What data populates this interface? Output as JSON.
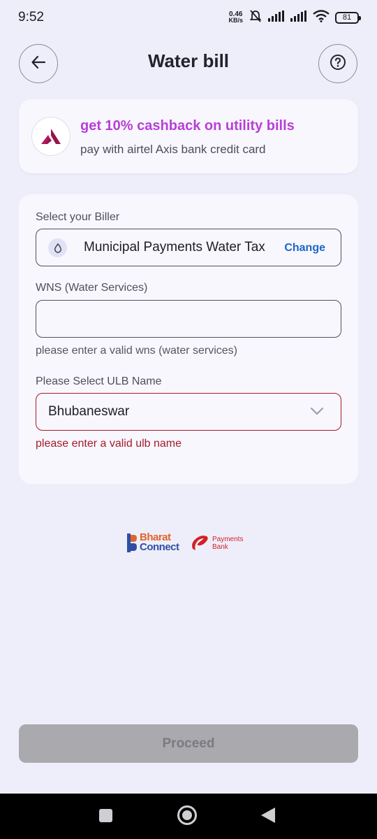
{
  "status_bar": {
    "time": "9:52",
    "net_speed_value": "0.46",
    "net_speed_unit": "KB/s",
    "battery": "81",
    "icons": [
      "mute-icon",
      "signal-icon",
      "signal-icon",
      "wifi-icon",
      "battery-icon"
    ]
  },
  "header": {
    "title": "Water bill",
    "back_icon": "arrow-left-icon",
    "help_icon": "question-circle-icon"
  },
  "promo": {
    "title": "get 10% cashback on utility bills",
    "subtitle": "pay with airtel Axis bank credit card",
    "logo": "axis-bank-logo",
    "title_color": "#B83ED8"
  },
  "form": {
    "biller_label": "Select your Biller",
    "biller_name": "Municipal Payments Water Tax",
    "biller_change": "Change",
    "wns_label": "WNS (Water Services)",
    "wns_value": "",
    "wns_helper": "please enter a valid wns (water services)",
    "ulb_label": "Please Select ULB Name",
    "ulb_value": "Bhubaneswar",
    "ulb_error": "please enter a valid ulb name",
    "error_color": "#A51B2A",
    "link_color": "#1B66C9"
  },
  "logos": {
    "bharat_line1": "Bharat",
    "bharat_line2": "Connect",
    "airtel_line1": "Payments",
    "airtel_line2": "Bank"
  },
  "footer": {
    "proceed_label": "Proceed"
  }
}
